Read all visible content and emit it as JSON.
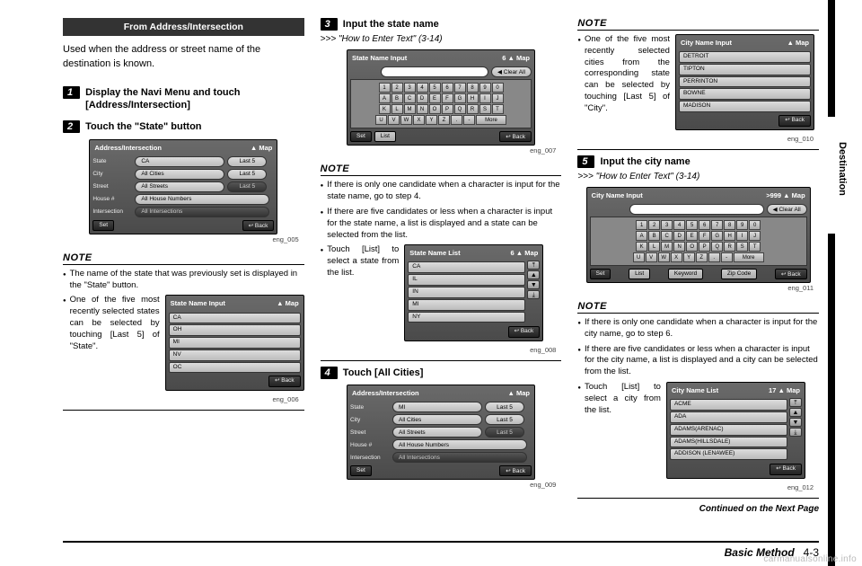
{
  "sideTab": "Destination",
  "col1": {
    "banner": "From Address/Intersection",
    "intro": "Used when the address or street name of the destination is known.",
    "step1_num": "1",
    "step1": "Display the Navi Menu and touch [Address/Intersection]",
    "step2_num": "2",
    "step2": "Touch the \"State\" button",
    "fig005": {
      "title": "Address/Intersection",
      "map": "▲ Map",
      "rows": {
        "state_lbl": "State",
        "state_val": "CA",
        "state_last": "Last 5",
        "city_lbl": "City",
        "city_val": "All Cities",
        "city_last": "Last 5",
        "street_lbl": "Street",
        "street_val": "All Streets",
        "street_last": "Last 5",
        "house_lbl": "House #",
        "house_val": "All House Numbers",
        "inter_lbl": "Intersection",
        "inter_val": "All Intersections"
      },
      "set": "Set",
      "back": "↩ Back",
      "cap": "eng_005"
    },
    "noteHead": "NOTE",
    "note1": "The name of the state that was previously set is displayed in the \"State\" button.",
    "note2": "One of the five most recently selected states can be selected by touching [Last 5] of \"State\".",
    "fig006": {
      "title": "State Name Input",
      "map": "▲ Map",
      "rows": [
        "CA",
        "OH",
        "MI",
        "NV",
        "OC"
      ],
      "back": "↩ Back",
      "cap": "eng_006"
    }
  },
  "col2": {
    "step3_num": "3",
    "step3": "Input the state name",
    "ref3": ">>> \"How to Enter Text\" (3-14)",
    "fig007": {
      "title": "State Name Input",
      "count": "6 ▲ Map",
      "clear": "◀ Clear All",
      "nums": [
        "1",
        "2",
        "3",
        "4",
        "5",
        "6",
        "7",
        "8",
        "9",
        "0"
      ],
      "r1": [
        "A",
        "B",
        "C",
        "D",
        "E",
        "F",
        "G",
        "H",
        "I",
        "J"
      ],
      "r2": [
        "K",
        "L",
        "M",
        "N",
        "O",
        "P",
        "Q",
        "R",
        "S",
        "T"
      ],
      "r3": [
        "U",
        "V",
        "W",
        "X",
        "Y",
        "Z",
        ".",
        "-"
      ],
      "more": "More",
      "set": "Set",
      "list": "List",
      "back": "↩ Back",
      "cap": "eng_007"
    },
    "noteHead": "NOTE",
    "n1": "If there is only one candidate when a character is input for the state name, go to step 4.",
    "n2": "If there are five candidates or less when a character is input for the state name, a list is displayed and a state can be selected from the list.",
    "n3": "Touch [List] to select a state from the list.",
    "fig008": {
      "title": "State Name List",
      "count": "6 ▲ Map",
      "rows": [
        "CA",
        "IL",
        "IN",
        "MI",
        "NY"
      ],
      "back": "↩ Back",
      "cap": "eng_008"
    },
    "step4_num": "4",
    "step4": "Touch [All Cities]",
    "fig009": {
      "title": "Address/Intersection",
      "map": "▲ Map",
      "rows": {
        "state_lbl": "State",
        "state_val": "MI",
        "state_last": "Last 5",
        "city_lbl": "City",
        "city_val": "All Cities",
        "city_last": "Last 5",
        "street_lbl": "Street",
        "street_val": "All Streets",
        "street_last": "Last 5",
        "house_lbl": "House #",
        "house_val": "All House Numbers",
        "inter_lbl": "Intersection",
        "inter_val": "All Intersections"
      },
      "set": "Set",
      "back": "↩ Back",
      "cap": "eng_009"
    }
  },
  "col3": {
    "noteHeadTop": "NOTE",
    "topNote": "One of the five most recently selected cities from the corresponding state can be selected by touching [Last 5] of \"City\".",
    "fig010": {
      "title": "City Name Input",
      "map": "▲ Map",
      "rows": [
        "DETROIT",
        "TIPTON",
        "PERRINTON",
        "BOWNE",
        "MADISON"
      ],
      "back": "↩ Back",
      "cap": "eng_010"
    },
    "step5_num": "5",
    "step5": "Input the city name",
    "ref5": ">>> \"How to Enter Text\" (3-14)",
    "fig011": {
      "title": "City Name Input",
      "count": ">999 ▲ Map",
      "clear": "◀ Clear All",
      "nums": [
        "1",
        "2",
        "3",
        "4",
        "5",
        "6",
        "7",
        "8",
        "9",
        "0"
      ],
      "r1": [
        "A",
        "B",
        "C",
        "D",
        "E",
        "F",
        "G",
        "H",
        "I",
        "J"
      ],
      "r2": [
        "K",
        "L",
        "M",
        "N",
        "O",
        "P",
        "Q",
        "R",
        "S",
        "T"
      ],
      "r3": [
        "U",
        "V",
        "W",
        "X",
        "Y",
        "Z",
        ".",
        "-"
      ],
      "more": "More",
      "set": "Set",
      "list": "List",
      "kw": "Keyword",
      "zip": "Zip Code",
      "back": "↩ Back",
      "cap": "eng_011"
    },
    "noteHead": "NOTE",
    "n1": "If there is only one candidate when a character is input for the city name, go to step 6.",
    "n2": "If there are five candidates or less when a character is input for the city name, a list is displayed and a city can be selected from the list.",
    "n3": "Touch [List] to select a city from the list.",
    "fig012": {
      "title": "City Name List",
      "count": "17 ▲ Map",
      "rows": [
        "ACME",
        "ADA",
        "ADAMS(ARENAC)",
        "ADAMS(HILLSDALE)",
        "ADDISON (LENAWEE)"
      ],
      "back": "↩ Back",
      "cap": "eng_012"
    },
    "cont": "Continued on the Next Page"
  },
  "footer": {
    "section": "Basic Method",
    "page": "4-3"
  },
  "watermark": "carmanualsonline.info"
}
